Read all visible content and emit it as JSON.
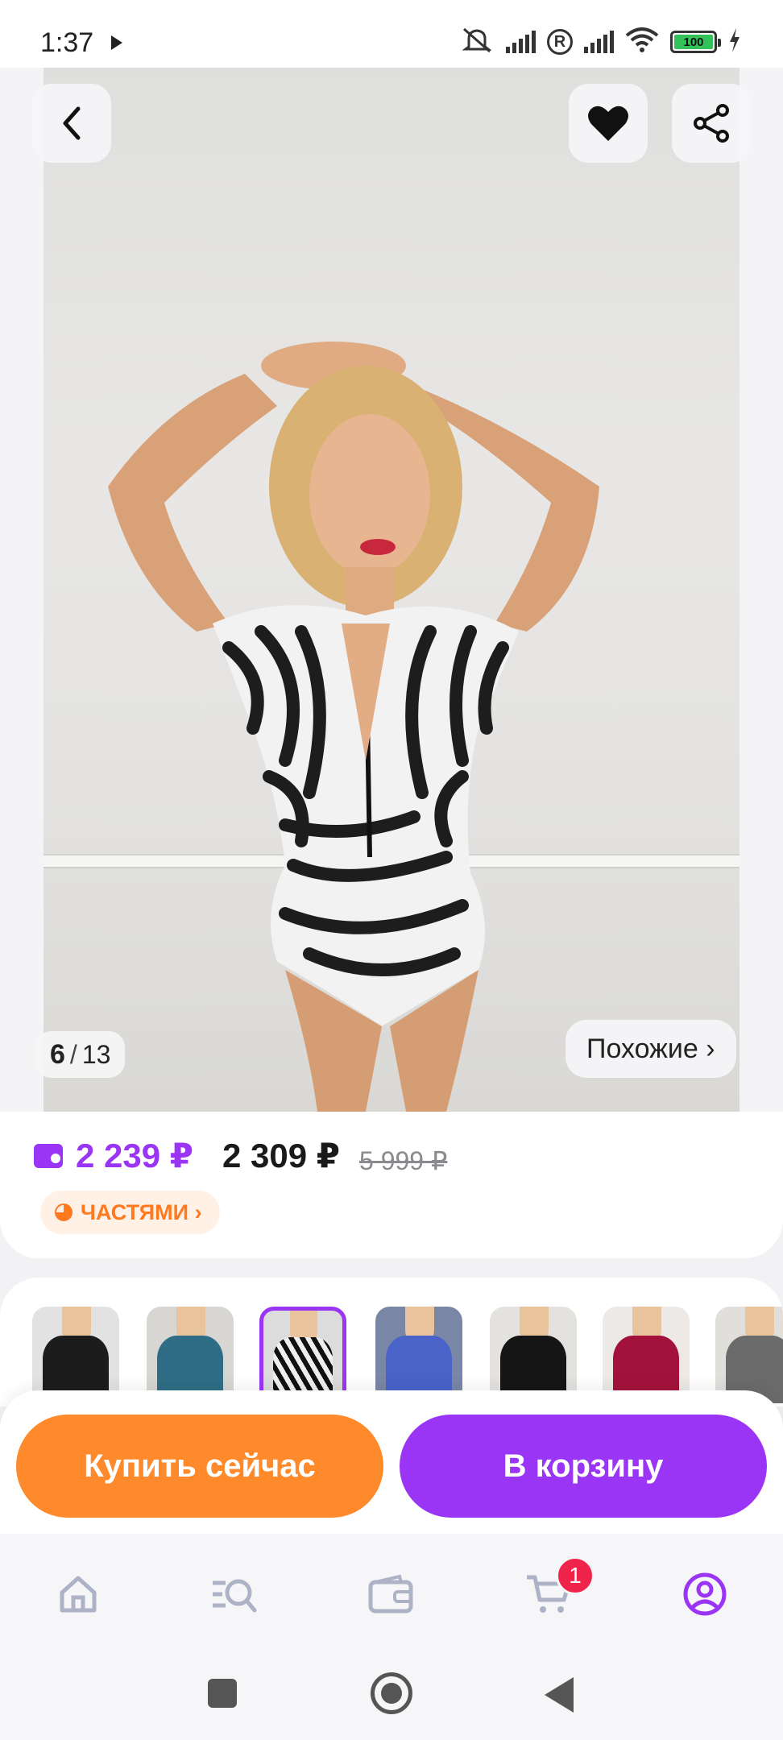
{
  "status_bar": {
    "time": "1:37",
    "battery_level": "100",
    "icons": [
      "play-icon",
      "mute-icon",
      "signal-icon",
      "roaming-icon",
      "signal-icon",
      "wifi-icon",
      "battery-icon",
      "charging-icon"
    ]
  },
  "gallery": {
    "current_index": "6",
    "separator": "/",
    "total": "13",
    "similar_label": "Похожие ›",
    "icons": {
      "back": "chevron-left-icon",
      "favorite": "heart-icon",
      "share": "share-icon"
    }
  },
  "price": {
    "wallet_price": "2 239 ₽",
    "current_price": "2 309 ₽",
    "old_price": "5 999 ₽",
    "installments_label": "ЧАСТЯМИ ›"
  },
  "variants": {
    "selected_index": 2,
    "items": [
      {
        "color": "#1c1c1c",
        "bg": "#e2e2e2"
      },
      {
        "color": "#2f6d86",
        "bg": "#d8d6d2"
      },
      {
        "color": "#e8e8e8",
        "bg": "#dcdcdc"
      },
      {
        "color": "#4a63c9",
        "bg": "#7a86a6"
      },
      {
        "color": "#151515",
        "bg": "#e4e2df"
      },
      {
        "color": "#a3123a",
        "bg": "#ece9e6"
      },
      {
        "color": "#6b6b6b",
        "bg": "#e0dfdc"
      }
    ]
  },
  "actions": {
    "buy_now": "Купить сейчас",
    "add_to_cart": "В корзину"
  },
  "bottom_nav": {
    "cart_count": "1",
    "items": [
      "home-icon",
      "catalog-search-icon",
      "wallet-icon",
      "cart-icon",
      "profile-icon"
    ],
    "active": "profile-icon"
  },
  "colors": {
    "accent_purple": "#9b35f5",
    "accent_orange": "#ff8a2b",
    "badge_red": "#f0234b"
  }
}
